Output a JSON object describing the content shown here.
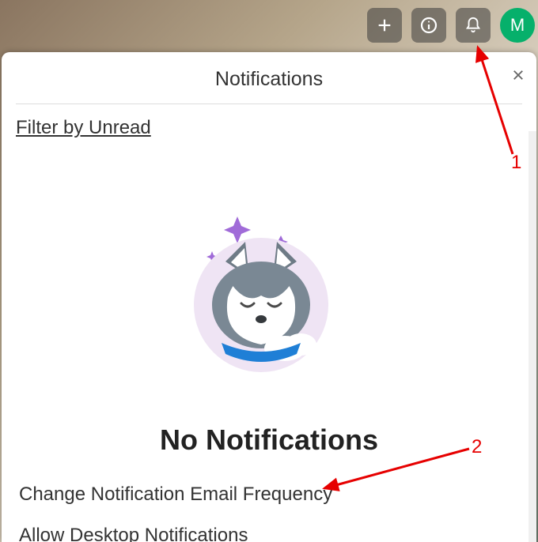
{
  "header": {
    "avatar_initial": "M"
  },
  "panel": {
    "title": "Notifications",
    "filter_link": "Filter by Unread",
    "empty_title": "No Notifications",
    "link_email_frequency": "Change Notification Email Frequency",
    "link_desktop": "Allow Desktop Notifications"
  },
  "annotations": {
    "label1": "1",
    "label2": "2"
  },
  "colors": {
    "annotation": "#e60000",
    "avatar_bg": "#06b06b"
  }
}
